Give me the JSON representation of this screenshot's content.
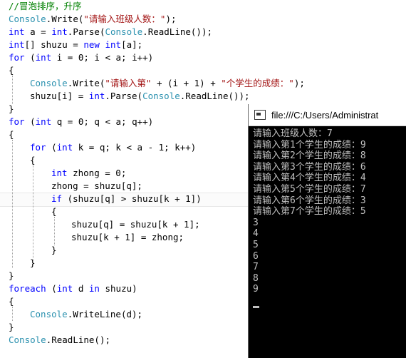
{
  "code": {
    "comment": "//冒泡排序，升序",
    "l1_str": "\"请输入班级人数：\"",
    "l5_str1": "\"请输入第\"",
    "l5_str2": "\"个学生的成绩：\"",
    "lines": [
      "Console.Write(\"请输入班级人数：\");",
      "int a = int.Parse(Console.ReadLine());",
      "int[] shuzu = new int[a];",
      "for (int i = 0; i < a; i++)",
      "{",
      "Console.Write(\"请输入第\" + (i + 1) + \"个学生的成绩：\");",
      "shuzu[i] = int.Parse(Console.ReadLine());",
      "}",
      "for (int q = 0; q < a; q++)",
      "{",
      "for (int k = q; k < a - 1; k++)",
      "{",
      "int zhong = 0;",
      "zhong = shuzu[q];",
      "if (shuzu[q] > shuzu[k + 1])",
      "{",
      "shuzu[q] = shuzu[k + 1];",
      "shuzu[k + 1] = zhong;",
      "}",
      "}",
      "}",
      "foreach (int d in shuzu)",
      "{",
      "Console.WriteLine(d);",
      "}",
      "Console.ReadLine();"
    ]
  },
  "console": {
    "title": "file:///C:/Users/Administrat",
    "output": [
      "请输入班级人数：7",
      "请输入第1个学生的成绩：9",
      "请输入第2个学生的成绩：8",
      "请输入第3个学生的成绩：6",
      "请输入第4个学生的成绩：4",
      "请输入第5个学生的成绩：7",
      "请输入第6个学生的成绩：3",
      "请输入第7个学生的成绩：5",
      "3",
      "4",
      "5",
      "6",
      "7",
      "8",
      "9"
    ]
  }
}
